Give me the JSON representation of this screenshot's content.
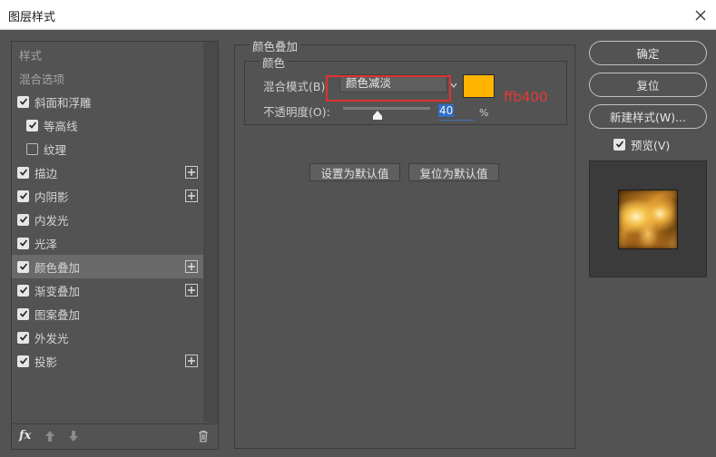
{
  "window": {
    "title": "图层样式"
  },
  "styles_list": {
    "header": "样式",
    "blend_options": "混合选项",
    "items": [
      {
        "label": "斜面和浮雕",
        "checked": true,
        "has_add": false
      },
      {
        "label": "等高线",
        "checked": true,
        "has_add": false
      },
      {
        "label": "纹理",
        "checked": false,
        "has_add": false
      },
      {
        "label": "描边",
        "checked": true,
        "has_add": true
      },
      {
        "label": "内阴影",
        "checked": true,
        "has_add": true
      },
      {
        "label": "内发光",
        "checked": true,
        "has_add": false
      },
      {
        "label": "光泽",
        "checked": true,
        "has_add": false
      },
      {
        "label": "颜色叠加",
        "checked": true,
        "has_add": true,
        "selected": true
      },
      {
        "label": "渐变叠加",
        "checked": true,
        "has_add": true
      },
      {
        "label": "图案叠加",
        "checked": true,
        "has_add": false
      },
      {
        "label": "外发光",
        "checked": true,
        "has_add": false
      },
      {
        "label": "投影",
        "checked": true,
        "has_add": true
      }
    ],
    "footer_fx": "fx"
  },
  "color_overlay": {
    "group_title": "颜色叠加",
    "color_group_title": "颜色",
    "blend_mode_label": "混合模式(B):",
    "blend_mode_value": "颜色减淡",
    "swatch_color": "#ffb400",
    "annotation": "ffb400",
    "opacity_label": "不透明度(O):",
    "opacity_value": "40",
    "opacity_unit": "%",
    "opacity_fraction": 0.4,
    "set_default_label": "设置为默认值",
    "reset_default_label": "复位为默认值"
  },
  "actions": {
    "ok_label": "确定",
    "reset_label": "复位",
    "new_style_label": "新建样式(W)...",
    "preview_label": "预览(V)",
    "preview_checked": true
  }
}
